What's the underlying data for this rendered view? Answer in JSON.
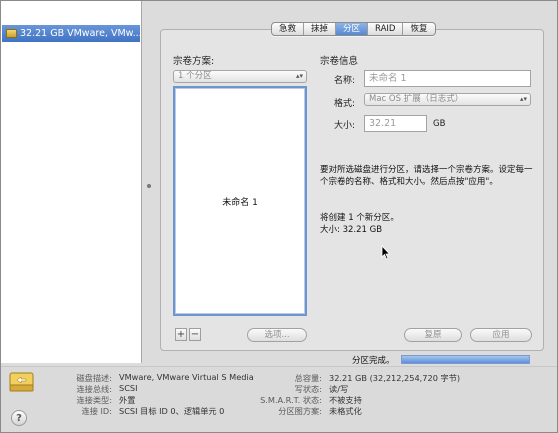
{
  "sidebar": {
    "disk_label": "32.21 GB VMware, VMw..."
  },
  "tabs": [
    {
      "label": "急救",
      "selected": false
    },
    {
      "label": "抹掉",
      "selected": false
    },
    {
      "label": "分区",
      "selected": true
    },
    {
      "label": "RAID",
      "selected": false
    },
    {
      "label": "恢复",
      "selected": false
    }
  ],
  "volume_scheme": {
    "title": "宗卷方案:",
    "selected": "1 个分区",
    "partition_name": "未命名 1",
    "add_label": "+",
    "remove_label": "−",
    "options_label": "选项..."
  },
  "volume_info": {
    "title": "宗卷信息",
    "name_label": "名称:",
    "name_placeholder": "未命名 1",
    "format_label": "格式:",
    "format_value": "Mac OS 扩展（日志式）",
    "size_label": "大小:",
    "size_value": "32.21",
    "size_unit": "GB",
    "instructions": "要对所选磁盘进行分区，请选择一个宗卷方案。设定每一个宗卷的名称、格式和大小。然后点按\"应用\"。",
    "result_line1": "将创建 1 个新分区。",
    "result_line2": "大小: 32.21 GB"
  },
  "actions": {
    "revert_label": "复原",
    "apply_label": "应用"
  },
  "status": {
    "label": "分区完成。",
    "progress": 1.0
  },
  "disk_details": {
    "description_key": "磁盘描述:",
    "description_value": "VMware, VMware Virtual S Media",
    "bus_key": "连接总线:",
    "bus_value": "SCSI",
    "type_key": "连接类型:",
    "type_value": "外置",
    "id_key": "连接 ID:",
    "id_value": "SCSI 目标 ID 0、逻辑单元 0",
    "capacity_key": "总容量:",
    "capacity_value": "32.21 GB (32,212,254,720 字节)",
    "write_key": "写状态:",
    "write_value": "读/写",
    "smart_key": "S.M.A.R.T. 状态:",
    "smart_value": "不被支持",
    "scheme_key": "分区图方案:",
    "scheme_value": "未格式化"
  },
  "help_label": "?",
  "colors": {
    "selection": "#4d82cf",
    "preview_border": "#6f95cf",
    "progress": "#5d8fd8"
  },
  "icons": [
    "disk-icon",
    "external-disk-icon",
    "help-icon",
    "splitter-grip-icon",
    "mouse-cursor-icon"
  ]
}
